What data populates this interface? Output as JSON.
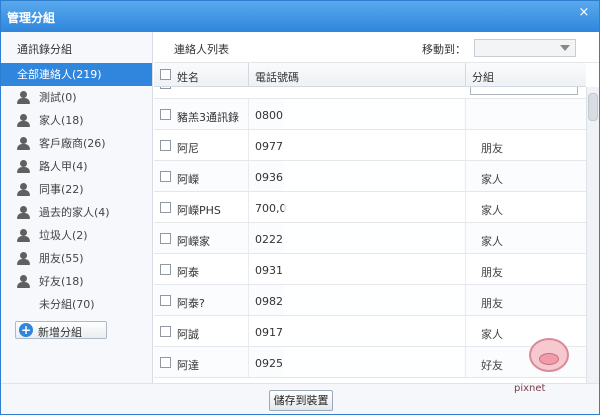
{
  "dialog": {
    "title": "管理分組",
    "close": "×"
  },
  "sidebar": {
    "title": "通訊錄分組",
    "groups": [
      {
        "label": "全部連絡人(219)"
      },
      {
        "label": "測試(0)"
      },
      {
        "label": "家人(18)"
      },
      {
        "label": "客戶廠商(26)"
      },
      {
        "label": "路人甲(4)"
      },
      {
        "label": "同事(22)"
      },
      {
        "label": "過去的家人(4)"
      },
      {
        "label": "垃圾人(2)"
      },
      {
        "label": "朋友(55)"
      },
      {
        "label": "好友(18)"
      },
      {
        "label": "未分組(70)"
      }
    ],
    "add_group_label": "新增分組",
    "add_icon": "+"
  },
  "main": {
    "list_title": "連絡人列表",
    "move_to_label": "移動到：",
    "move_select_value": "",
    "columns": {
      "name": "姓名",
      "phone": "電話號碼",
      "group": "分組"
    },
    "rows": [
      {
        "name": "",
        "phone": "",
        "group": ""
      },
      {
        "name": "豬羔3通訊錄",
        "phone": "0800",
        "group": ""
      },
      {
        "name": "阿尼",
        "phone": "0977",
        "group": "朋友"
      },
      {
        "name": "阿嶸",
        "phone": "0936",
        "group": "家人"
      },
      {
        "name": "阿嶸PHS",
        "phone": "700,0",
        "group": "家人"
      },
      {
        "name": "阿嶸家",
        "phone": "0222",
        "group": "家人"
      },
      {
        "name": "阿泰",
        "phone": "0931",
        "group": "朋友"
      },
      {
        "name": "阿泰?",
        "phone": "0982",
        "group": "朋友"
      },
      {
        "name": "阿誠",
        "phone": "0917",
        "group": "家人"
      },
      {
        "name": "阿達",
        "phone": "0925",
        "group": "好友"
      }
    ]
  },
  "footer": {
    "save_label": "儲存到裝置"
  },
  "watermark": {
    "text": "pixnet"
  },
  "colors": {
    "accent": "#2f86dc",
    "title_bar": "#3b8fdf"
  }
}
